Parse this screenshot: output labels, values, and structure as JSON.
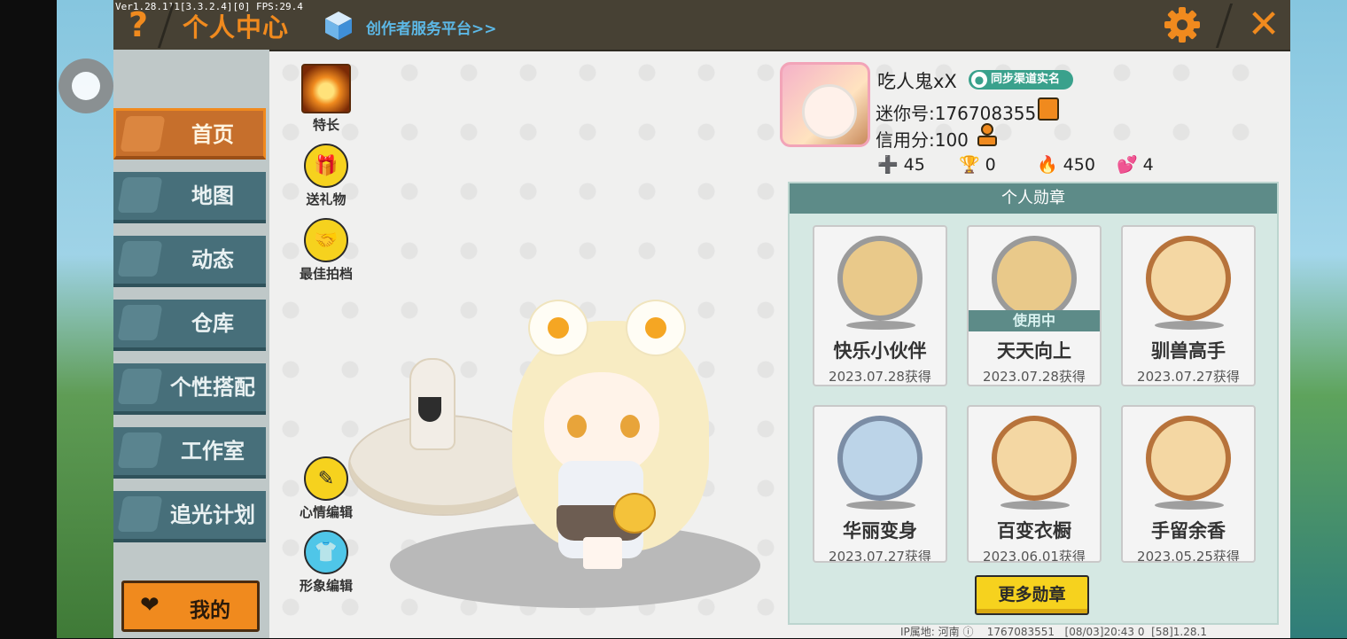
{
  "top_bar": {
    "version_text": "Ver1.28.1]1[3.3.2.4][0] FPS:29.4",
    "help_label": "?",
    "title": "个人中心",
    "creator_link": "创作者服务平台>>",
    "close_label": "✕"
  },
  "nav": {
    "items": [
      {
        "label": "首页",
        "icon": "home-icon",
        "active": true
      },
      {
        "label": "地图",
        "icon": "map-icon",
        "active": false
      },
      {
        "label": "动态",
        "icon": "bell-icon",
        "active": false
      },
      {
        "label": "仓库",
        "icon": "storage-icon",
        "active": false
      },
      {
        "label": "个性搭配",
        "icon": "outfit-icon",
        "active": false
      },
      {
        "label": "工作室",
        "icon": "studio-icon",
        "active": false
      },
      {
        "label": "追光计划",
        "icon": "plan-icon",
        "active": false
      }
    ],
    "my_button": "我的"
  },
  "actions": {
    "specialty": "特长",
    "send_gift": "送礼物",
    "best_partner": "最佳拍档",
    "mood_edit": "心情编辑",
    "image_edit": "形象编辑"
  },
  "profile": {
    "username": "吃人鬼xX",
    "sync_badge": "同步渠道实名",
    "mini_id": "迷你号:1767083551",
    "credit": "信用分:100",
    "stats": [
      {
        "icon": "plus-icon",
        "value": "45"
      },
      {
        "icon": "trophy-icon",
        "value": "0"
      },
      {
        "icon": "flame-icon",
        "value": "450"
      },
      {
        "icon": "hearts-icon",
        "value": "4"
      }
    ]
  },
  "badges": {
    "title": "个人勋章",
    "items": [
      {
        "name": "快乐小伙伴",
        "date": "2023.07.28获得",
        "frame": "silver",
        "in_use": false
      },
      {
        "name": "天天向上",
        "date": "2023.07.28获得",
        "frame": "silver",
        "in_use": true
      },
      {
        "name": "驯兽高手",
        "date": "2023.07.27获得",
        "frame": "wood",
        "in_use": false
      },
      {
        "name": "华丽变身",
        "date": "2023.07.27获得",
        "frame": "blue",
        "in_use": false
      },
      {
        "name": "百变衣橱",
        "date": "2023.06.01获得",
        "frame": "wood",
        "in_use": false
      },
      {
        "name": "手留余香",
        "date": "2023.05.25获得",
        "frame": "wood",
        "in_use": false
      }
    ],
    "in_use_label": "使用中",
    "more_button": "更多勋章"
  },
  "footer": {
    "ip": "IP属地: 河南",
    "uid": "1767083551",
    "time": "[08/03]20:43 0",
    "version": "[58]1.28.1"
  },
  "colors": {
    "accent": "#f08a1e",
    "panel_header": "#5d8b88",
    "nav_item": "#476f7a"
  }
}
